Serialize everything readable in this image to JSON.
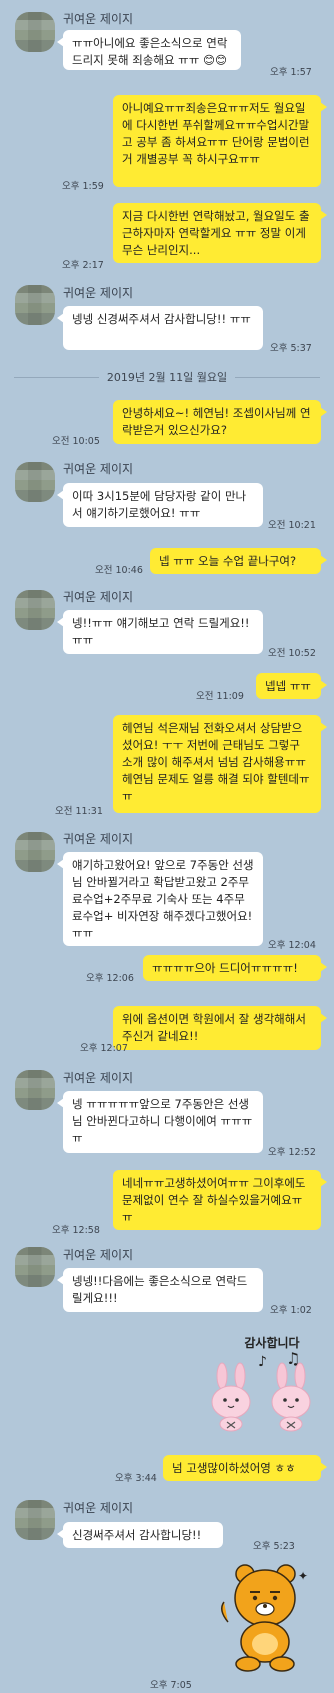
{
  "date_divider": "2019년 2월 11일 월요일",
  "contact_name": "귀여운 제이지",
  "messages": [
    {
      "text": "ㅠㅠ아니에요 좋은소식으로 연락드리지 못해 죄송해요 ㅠㅠ 😊😊",
      "time": "오후 1:57"
    },
    {
      "text": "아니예요ㅠㅠ죄송은요ㅠㅠ저도 월요일에 다시한번 푸쉬할께요ㅠㅠ수업시간말고 공부 좀 하셔요ㅠㅠ 단어랑 문법이런거 개별공부 꼭 하시구요ㅠㅠ",
      "time": "오후 1:59"
    },
    {
      "text": "지금 다시한번 연락해놨고, 월요일도 출근하자마자 연락할게요 ㅠㅠ 정말 이게 무슨 난리인지...",
      "time": "오후 2:17"
    },
    {
      "text": "넹넹 신경써주셔서 감사합니당!! ㅠㅠ",
      "time": "오후 5:37"
    },
    {
      "text": "안녕하세요~! 헤연님! 조셉이사님께 연락받은거 있으신가요?",
      "time": "오전 10:05"
    },
    {
      "text": "이따 3시15분에 담당자랑 같이 만나서 얘기하기로했어요! ㅠㅠ",
      "time": "오전 10:21"
    },
    {
      "text": "넵 ㅠㅠ 오늘 수업 끝나구여?",
      "time": "오전 10:46"
    },
    {
      "text": "넹!!ㅠㅠ 얘기해보고 연락 드릴게요!! ㅠㅠ",
      "time": "오전 10:52"
    },
    {
      "text": "넵넵 ㅠㅠ",
      "time": "오전 11:09"
    },
    {
      "text": "헤연님 석은재님 전화오셔서 상담받으셨어요! ㅜㅜ 저번에 근태님도 그렇구 소개 많이 해주셔서 넘넘 감사해용ㅠㅠ 헤연님 문제도 얼릉 해결 되야 할텐데ㅠㅠ",
      "time": "오전 11:31"
    },
    {
      "text": "얘기하고왔어요! 앞으로 7주동안 선생님 안바뀔거라고 확답받고왔고 2주무료수업+2주무료 기숙사 또는 4주무료수업+ 비자연장 해주겠다고했어요! ㅠㅠ",
      "time": "오후 12:04"
    },
    {
      "text": "ㅠㅠㅠㅠ으아 드디어ㅠㅠㅠㅠ!",
      "time": "오후 12:06"
    },
    {
      "text": "위에 옵션이면 학원에서 잘 생각해해서 주신거 같네요!!",
      "time": "오후 12:07"
    },
    {
      "text": "넹 ㅠㅠㅠㅠㅠ앞으로 7주동안은 선생님 안바뀐다고하니 다행이에여 ㅠㅠㅠㅠ",
      "time": "오후 12:52"
    },
    {
      "text": "네네ㅠㅠ고생하셨어여ㅠㅠ 그이후에도 문제없이 연수 잘 하실수있을거예요ㅠㅠ",
      "time": "오후 12:58"
    },
    {
      "text": "넹넹!!다음에는 좋은소식으로 연락드릴게요!!!",
      "time": "오후 1:02"
    },
    {
      "sticker_text": "감사합니다",
      "time": "오후 3:44"
    },
    {
      "text": "넘 고생많이하셨어영 ㅎㅎ",
      "time": "오후 3:44"
    },
    {
      "text": "신경써주셔서 감사합니당!!",
      "time": "오후 5:23"
    },
    {
      "time": "오후 7:05"
    }
  ],
  "colors": {
    "background": "#b2c7d9",
    "incoming_bubble": "#ffffff",
    "outgoing_bubble": "#ffeb33"
  },
  "icons": [
    "contact-avatar",
    "bunny-sticker",
    "bear-sticker"
  ]
}
